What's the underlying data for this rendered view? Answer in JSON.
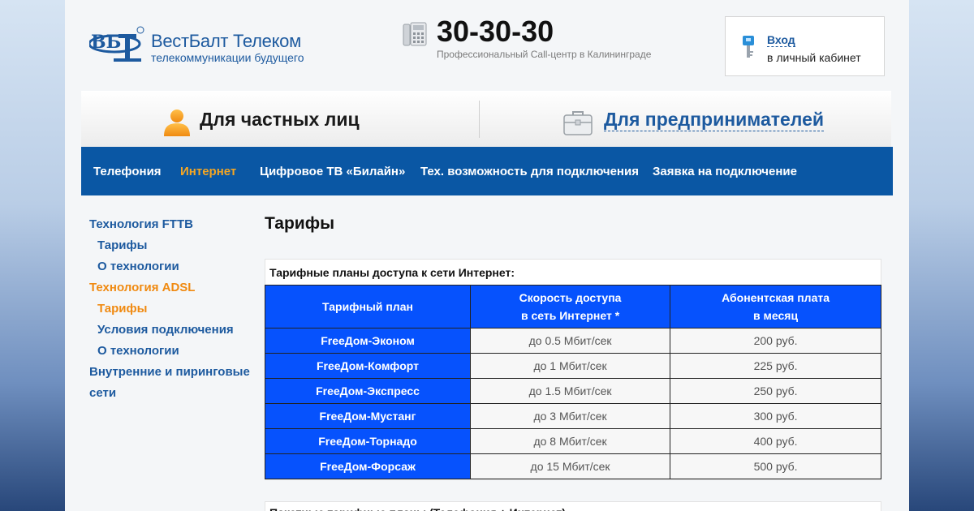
{
  "brand": {
    "logo_mark_text": "ВБТ",
    "name": "ВестБалт Телеком",
    "tagline": "телекоммуникации будущего",
    "color": "#1d5a9f"
  },
  "phone": {
    "number": "30-30-30",
    "subtitle": "Профессиональный Call-центр в Калининграде"
  },
  "login": {
    "link": "Вход",
    "subtitle": "в личный кабинет"
  },
  "segments": {
    "private": "Для частных лиц",
    "business": "Для предпринимателей"
  },
  "nav": {
    "items": [
      {
        "label": "Телефония"
      },
      {
        "label": "Интернет"
      },
      {
        "label": "Цифровое ТВ «Билайн»"
      },
      {
        "label": "Тех. возможность для подключения"
      },
      {
        "label": "Заявка на подключение"
      }
    ],
    "active": "Интернет",
    "active_color": "#f5a623",
    "bg_color": "#0a57a4"
  },
  "sidebar": {
    "items": [
      {
        "label": "Технология FTTB"
      },
      {
        "label": "Тарифы"
      },
      {
        "label": "О технологии"
      },
      {
        "label": "Технология ADSL"
      },
      {
        "label": "Тарифы"
      },
      {
        "label": "Условия подключения"
      },
      {
        "label": "О технологии"
      },
      {
        "label": "Внутренние и пиринговые"
      },
      {
        "label": "сети"
      }
    ]
  },
  "main": {
    "title": "Тарифы",
    "table": {
      "caption": "Тарифные планы доступа к сети Интернет:",
      "headers": {
        "plan": "Тарифный план",
        "speed_line1": "Скорость доступа",
        "speed_line2": "в сеть Интернет *",
        "fee_line1": "Абонентская плата",
        "fee_line2": "в месяц"
      },
      "rows": [
        {
          "plan": "FreeДом-Эконом",
          "speed": "до 0.5 Мбит/сек",
          "fee": "200 руб."
        },
        {
          "plan": "FreeДом-Комфорт",
          "speed": "до 1 Мбит/сек",
          "fee": "225 руб."
        },
        {
          "plan": "FreeДом-Экспресс",
          "speed": "до 1.5 Мбит/сек",
          "fee": "250 руб."
        },
        {
          "plan": "FreeДом-Мустанг",
          "speed": "до 3 Мбит/сек",
          "fee": "300 руб."
        },
        {
          "plan": "FreeДом-Торнадо",
          "speed": "до 8 Мбит/сек",
          "fee": "400 руб."
        },
        {
          "plan": "FreeДом-Форсаж",
          "speed": "до 15 Мбит/сек",
          "fee": "500 руб."
        }
      ],
      "header_color": "#0652fd"
    },
    "table2_caption": "Пакетные тарифные планы (Телефония + Интернет):"
  }
}
